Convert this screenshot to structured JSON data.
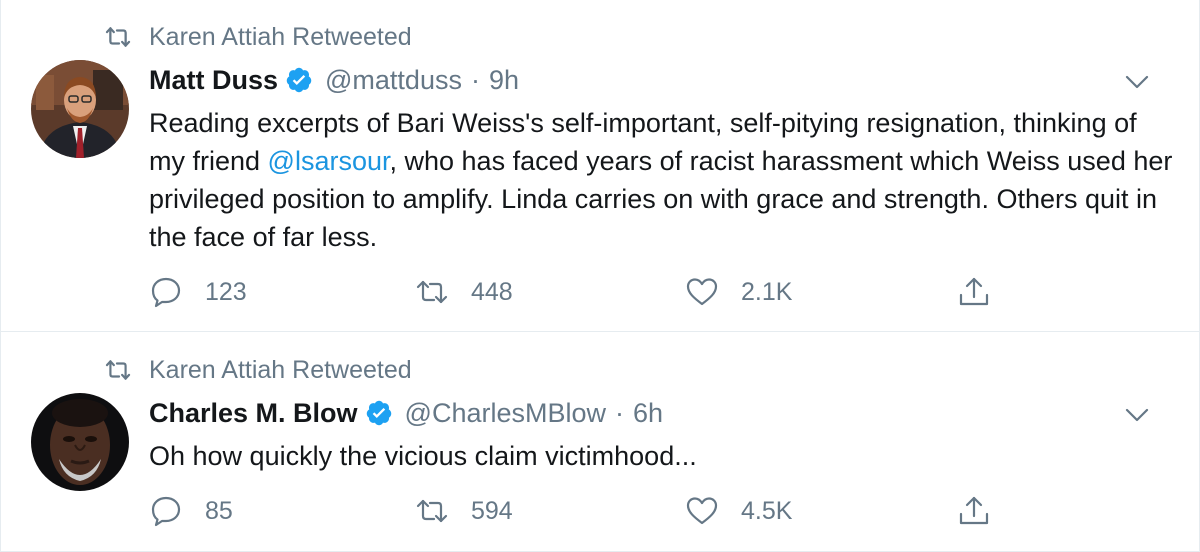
{
  "colors": {
    "accent": "#1da1f2",
    "link": "#1b95e0",
    "secondary_text": "#657786",
    "primary_text": "#14171a",
    "divider": "#e6ecf0"
  },
  "tweets": [
    {
      "retweeted_by": "Karen Attiah Retweeted",
      "author_name": "Matt Duss",
      "handle": "@mattduss",
      "separator": "·",
      "time": "9h",
      "verified": true,
      "avatar_icon": "avatar-photo",
      "text_parts": [
        "Reading excerpts of Bari Weiss's self-important, self-pitying resignation, thinking of my friend ",
        "@lsarsour",
        ", who has faced years of racist harassment which Weiss used her privileged position to amplify. Linda carries on with grace and strength. Others quit in the face of far less."
      ],
      "replies": "123",
      "retweets": "448",
      "likes": "2.1K"
    },
    {
      "retweeted_by": "Karen Attiah Retweeted",
      "author_name": "Charles M. Blow",
      "handle": "@CharlesMBlow",
      "separator": "·",
      "time": "6h",
      "verified": true,
      "avatar_icon": "avatar-photo",
      "text": "Oh how quickly the vicious claim victimhood...",
      "replies": "85",
      "retweets": "594",
      "likes": "4.5K"
    }
  ]
}
